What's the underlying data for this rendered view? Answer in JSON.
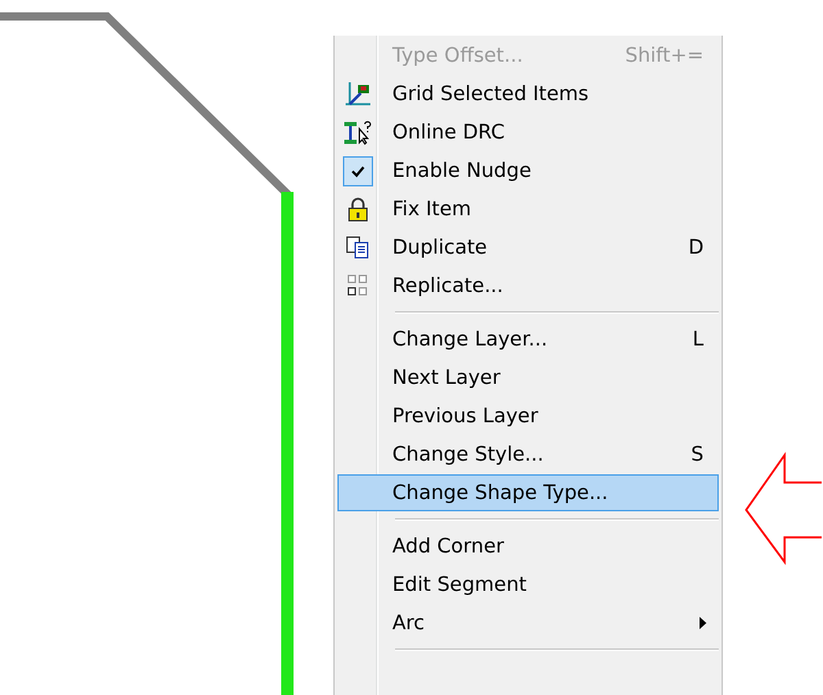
{
  "menu": {
    "items": [
      {
        "kind": "item",
        "label": "Type Offset...",
        "shortcut": "Shift+=",
        "checked": false,
        "selected": false,
        "submenu": false,
        "disabled": true
      },
      {
        "kind": "item",
        "label": "Grid Selected Items",
        "checked": false,
        "selected": false,
        "submenu": false,
        "disabled": false
      },
      {
        "kind": "item",
        "label": "Online DRC",
        "checked": false,
        "selected": false,
        "submenu": false,
        "disabled": false
      },
      {
        "kind": "item",
        "label": "Enable Nudge",
        "checked": true,
        "selected": false,
        "submenu": false,
        "disabled": false
      },
      {
        "kind": "item",
        "label": "Fix Item",
        "checked": false,
        "selected": false,
        "submenu": false,
        "disabled": false
      },
      {
        "kind": "item",
        "label": "Duplicate",
        "shortcut": "D",
        "checked": false,
        "selected": false,
        "submenu": false,
        "disabled": false
      },
      {
        "kind": "item",
        "label": "Replicate...",
        "checked": false,
        "selected": false,
        "submenu": false,
        "disabled": false
      },
      {
        "kind": "separator"
      },
      {
        "kind": "item",
        "label": "Change Layer...",
        "shortcut": "L",
        "checked": false,
        "selected": false,
        "submenu": false,
        "disabled": false
      },
      {
        "kind": "item",
        "label": "Next Layer",
        "checked": false,
        "selected": false,
        "submenu": false,
        "disabled": false
      },
      {
        "kind": "item",
        "label": "Previous Layer",
        "checked": false,
        "selected": false,
        "submenu": false,
        "disabled": false
      },
      {
        "kind": "item",
        "label": "Change Style...",
        "shortcut": "S",
        "checked": false,
        "selected": false,
        "submenu": false,
        "disabled": false
      },
      {
        "kind": "item",
        "label": "Change Shape Type...",
        "checked": false,
        "selected": true,
        "submenu": false,
        "disabled": false
      },
      {
        "kind": "separator"
      },
      {
        "kind": "item",
        "label": "Add Corner",
        "checked": false,
        "selected": false,
        "submenu": false,
        "disabled": false
      },
      {
        "kind": "item",
        "label": "Edit Segment",
        "checked": false,
        "selected": false,
        "submenu": false,
        "disabled": false
      },
      {
        "kind": "item",
        "label": "Arc",
        "checked": false,
        "selected": false,
        "submenu": true,
        "disabled": false
      },
      {
        "kind": "separator"
      }
    ]
  }
}
